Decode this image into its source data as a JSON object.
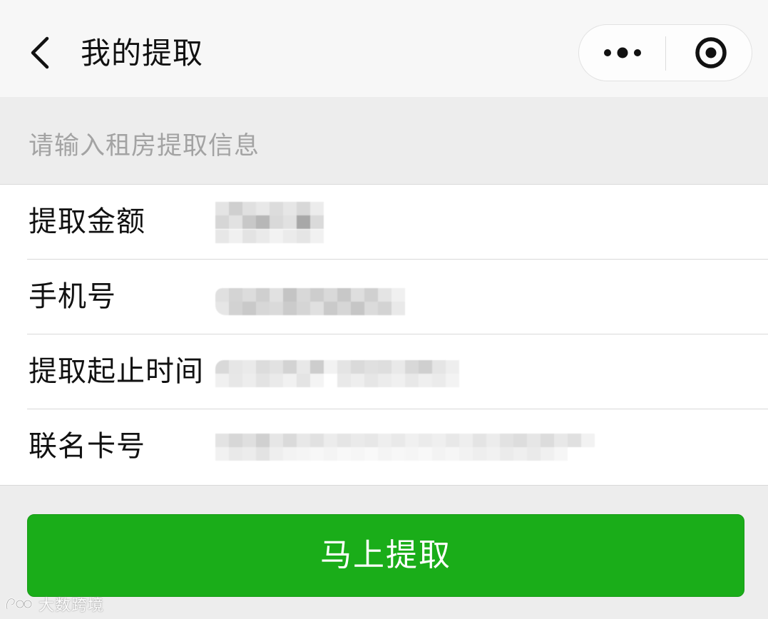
{
  "header": {
    "title": "我的提取",
    "back_icon": "chevron-left-icon",
    "more_icon": "more-dots-icon",
    "close_icon": "target-close-icon"
  },
  "form": {
    "section_hint": "请输入租房提取信息",
    "fields": [
      {
        "label": "提取金额",
        "value_state": "pixelated"
      },
      {
        "label": "手机号",
        "value_state": "pixelated"
      },
      {
        "label": "提取起止时间",
        "value_state": "pixelated"
      },
      {
        "label": "联名卡号",
        "value_state": "pixelated"
      }
    ]
  },
  "actions": {
    "submit_label": "马上提取"
  },
  "watermark": {
    "text": "大数跨境"
  },
  "colors": {
    "primary_green": "#1aad19",
    "hint_gray": "#a3a3a3",
    "page_bg": "#ededed",
    "navbar_bg": "#f7f7f7"
  }
}
